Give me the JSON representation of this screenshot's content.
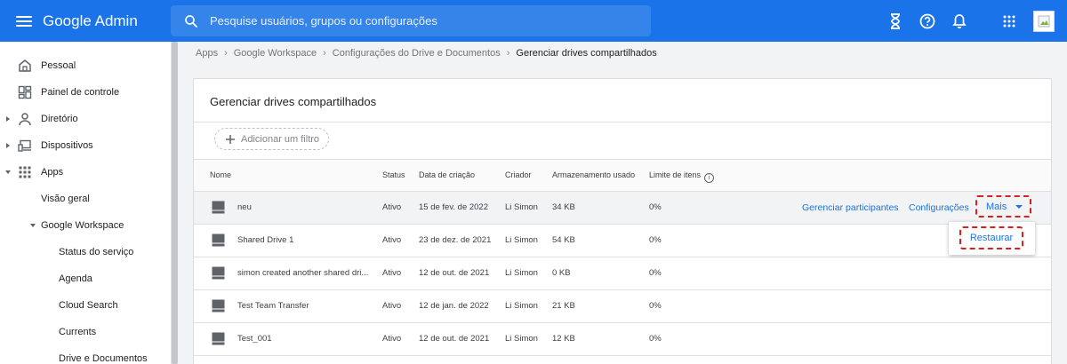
{
  "app": {
    "brand": "Google Admin",
    "search_placeholder": "Pesquise usuários, grupos ou configurações"
  },
  "topbar_icons": [
    "hourglass-icon",
    "help-icon",
    "notifications-icon",
    "apps-grid-icon",
    "account-avatar"
  ],
  "sidebar": {
    "items": [
      {
        "label": "Pessoal",
        "icon": "home-icon"
      },
      {
        "label": "Painel de controle",
        "icon": "dashboard-icon"
      },
      {
        "label": "Diretório",
        "icon": "person-icon"
      },
      {
        "label": "Dispositivos",
        "icon": "devices-icon"
      },
      {
        "label": "Apps",
        "icon": "apps-grid-icon"
      },
      {
        "label": "Visão geral"
      },
      {
        "label": "Google Workspace"
      },
      {
        "label": "Status do serviço"
      },
      {
        "label": "Agenda"
      },
      {
        "label": "Cloud Search"
      },
      {
        "label": "Currents"
      },
      {
        "label": "Drive e Documentos"
      }
    ]
  },
  "breadcrumb": {
    "items": [
      "Apps",
      "Google Workspace",
      "Configurações do Drive e Documentos"
    ],
    "current": "Gerenciar drives compartilhados"
  },
  "card": {
    "title": "Gerenciar drives compartilhados",
    "filter_label": "Adicionar um filtro"
  },
  "table": {
    "headers": {
      "name": "Nome",
      "status": "Status",
      "created": "Data de criação",
      "creator": "Criador",
      "storage": "Armazenamento usado",
      "limit": "Limite de itens"
    },
    "rows": [
      {
        "name": "neu",
        "status": "Ativo",
        "created": "15 de fev. de 2022",
        "creator": "Li Simon",
        "storage": "34 KB",
        "limit": "0%"
      },
      {
        "name": "Shared Drive 1",
        "status": "Ativo",
        "created": "23 de dez. de 2021",
        "creator": "Li Simon",
        "storage": "54 KB",
        "limit": "0%"
      },
      {
        "name": "simon created another shared dri...",
        "status": "Ativo",
        "created": "12 de out. de 2021",
        "creator": "Li Simon",
        "storage": "0 KB",
        "limit": "0%"
      },
      {
        "name": "Test Team Transfer",
        "status": "Ativo",
        "created": "12 de jan. de 2022",
        "creator": "Li Simon",
        "storage": "21 KB",
        "limit": "0%"
      },
      {
        "name": "Test_001",
        "status": "Ativo",
        "created": "12 de out. de 2021",
        "creator": "Li Simon",
        "storage": "12 KB",
        "limit": "0%"
      }
    ]
  },
  "row_actions": {
    "manage_members": "Gerenciar participantes",
    "settings": "Configurações",
    "more": "Mais",
    "restore": "Restaurar"
  },
  "colors": {
    "brand_blue": "#1a73e8",
    "highlight_red": "#d92020"
  }
}
